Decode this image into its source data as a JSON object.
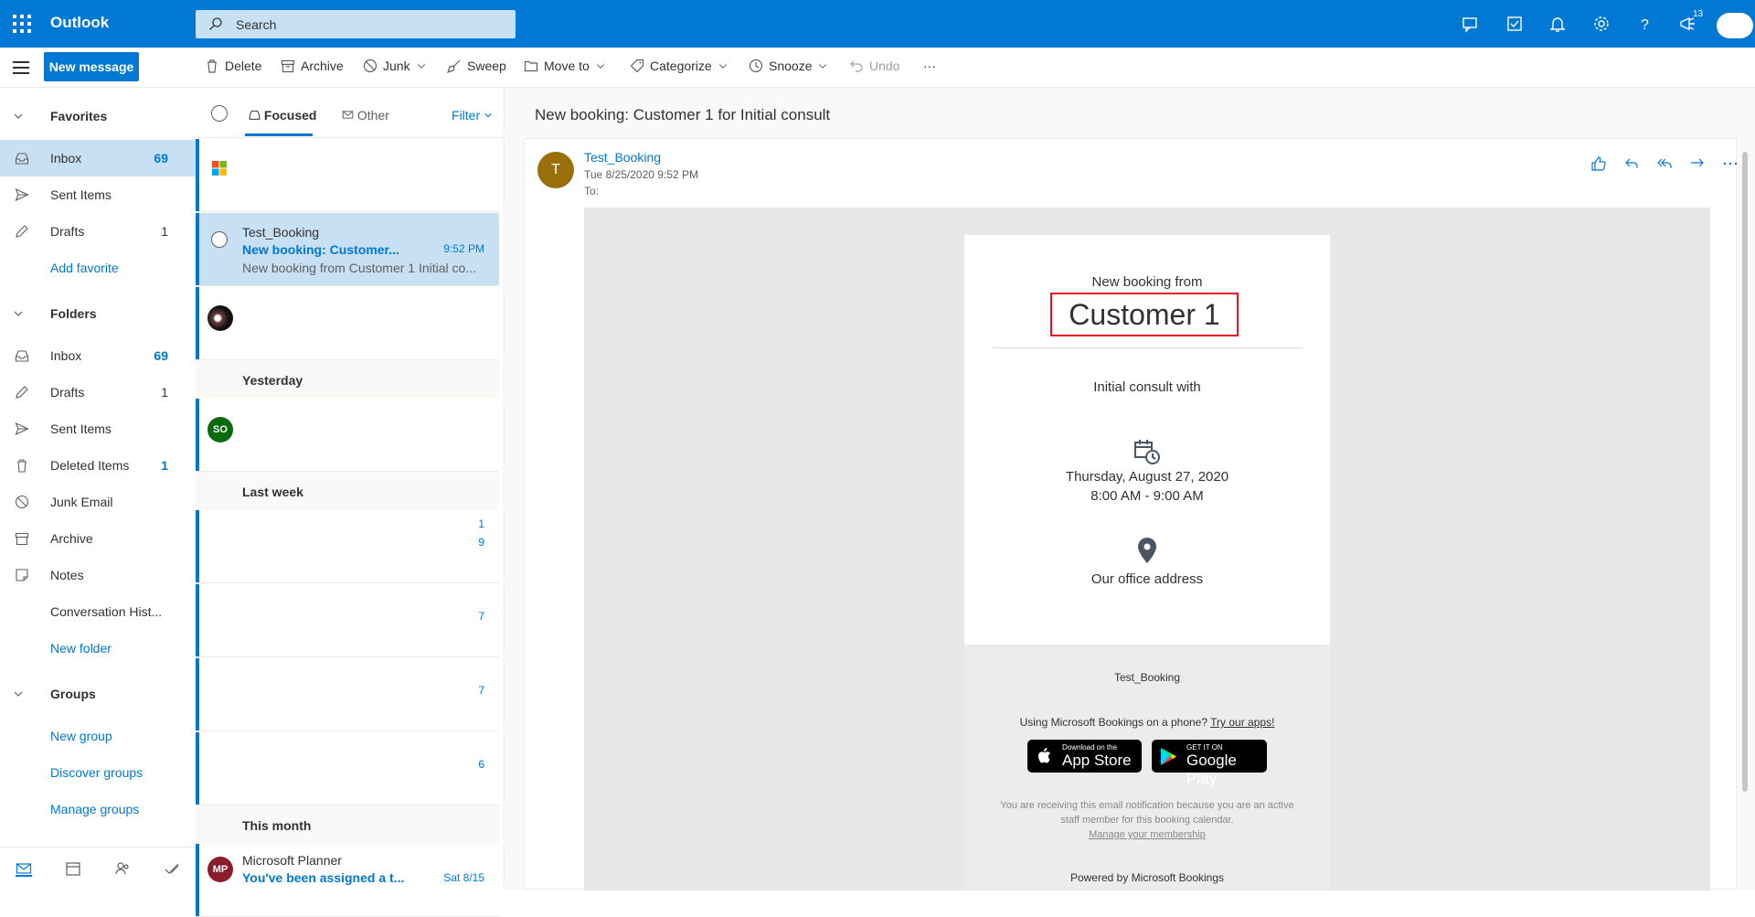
{
  "topbar": {
    "app_name": "Outlook",
    "search_placeholder": "Search",
    "notification_badge": "13"
  },
  "commands": {
    "new_message": "New message",
    "delete": "Delete",
    "archive": "Archive",
    "junk": "Junk",
    "sweep": "Sweep",
    "move_to": "Move to",
    "categorize": "Categorize",
    "snooze": "Snooze",
    "undo": "Undo",
    "more": "···"
  },
  "nav": {
    "favorites_title": "Favorites",
    "favorites": [
      {
        "label": "Inbox",
        "count": "69"
      },
      {
        "label": "Sent Items",
        "count": ""
      },
      {
        "label": "Drafts",
        "count": "1"
      },
      {
        "label": "Add favorite",
        "count": ""
      }
    ],
    "folders_title": "Folders",
    "folders": [
      {
        "label": "Inbox",
        "count": "69"
      },
      {
        "label": "Drafts",
        "count": "1"
      },
      {
        "label": "Sent Items",
        "count": ""
      },
      {
        "label": "Deleted Items",
        "count": "1"
      },
      {
        "label": "Junk Email",
        "count": ""
      },
      {
        "label": "Archive",
        "count": ""
      },
      {
        "label": "Notes",
        "count": ""
      },
      {
        "label": "Conversation Hist...",
        "count": ""
      },
      {
        "label": "New folder",
        "count": ""
      }
    ],
    "groups_title": "Groups",
    "groups": [
      {
        "label": "New group"
      },
      {
        "label": "Discover groups"
      },
      {
        "label": "Manage groups"
      }
    ]
  },
  "list": {
    "tab_focused": "Focused",
    "tab_other": "Other",
    "filter": "Filter",
    "selected_message": {
      "sender": "Test_Booking",
      "subject": "New booking: Customer...",
      "time": "9:52 PM",
      "preview": "New booking from Customer 1 Initial co..."
    },
    "group_yesterday": "Yesterday",
    "avatar_so": "SO",
    "group_last_week": "Last week",
    "lastweek_nums": [
      "1",
      "9",
      "7",
      "7",
      "6"
    ],
    "group_this_month": "This month",
    "planner": {
      "avatar": "MP",
      "sender": "Microsoft Planner",
      "subject": "You've been assigned a t...",
      "time": "Sat 8/15"
    }
  },
  "reading": {
    "title": "New booking: Customer 1 for Initial consult",
    "avatar_letter": "T",
    "sender": "Test_Booking",
    "date": "Tue 8/25/2020 9:52 PM",
    "to": "To:",
    "booking": {
      "from_label": "New booking from",
      "customer": "Customer 1",
      "service": "Initial consult with",
      "date": "Thursday, August 27, 2020",
      "time": "8:00 AM - 9:00 AM",
      "address": "Our office address",
      "footer_name": "Test_Booking",
      "phone_prompt": "Using Microsoft Bookings on a phone?",
      "try_apps": "Try our apps!",
      "appstore_small": "Download on the",
      "appstore_big": "App Store",
      "gplay_small": "GET IT ON",
      "gplay_big": "Google Play",
      "note": "You are receiving this email notification because you are an active staff member for this booking calendar.",
      "manage": "Manage your membership",
      "powered": "Powered by Microsoft Bookings"
    }
  },
  "colors": {
    "accent": "#0078d4",
    "selected": "#c7e0f4",
    "highlight_border": "#e81123"
  }
}
